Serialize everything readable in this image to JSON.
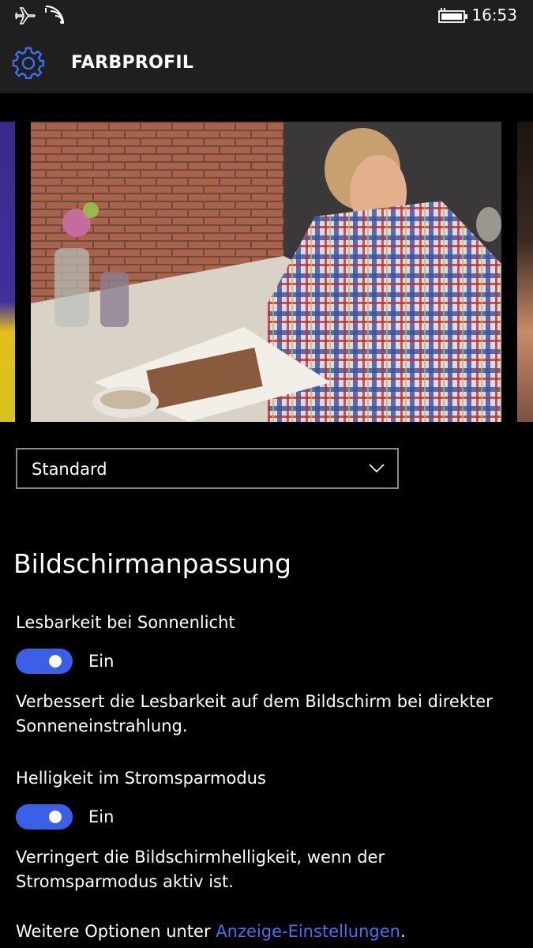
{
  "status_bar": {
    "time": "16:53",
    "icons": [
      "airplane-mode-icon",
      "wifi-icon",
      "battery-charging-icon"
    ]
  },
  "header": {
    "title": "FARBPROFIL",
    "icon": "gear-icon"
  },
  "colors": {
    "accent": "#3C5FE8",
    "link": "#4A6FF0",
    "header_bg": "#1F1F1F",
    "background": "#000000"
  },
  "color_profile": {
    "selected": "Standard"
  },
  "section": {
    "title": "Bildschirmanpassung"
  },
  "settings": [
    {
      "label": "Lesbarkeit bei Sonnenlicht",
      "state": "Ein",
      "description": "Verbessert die Lesbarkeit auf dem Bildschirm bei direkter Sonneneinstrahlung."
    },
    {
      "label": "Helligkeit im Stromsparmodus",
      "state": "Ein",
      "description": "Verringert die Bildschirmhelligkeit, wenn der Stromsparmodus aktiv ist."
    }
  ],
  "footer": {
    "text": "Weitere Optionen unter ",
    "link": "Anzeige-Einstellungen",
    "suffix": "."
  }
}
